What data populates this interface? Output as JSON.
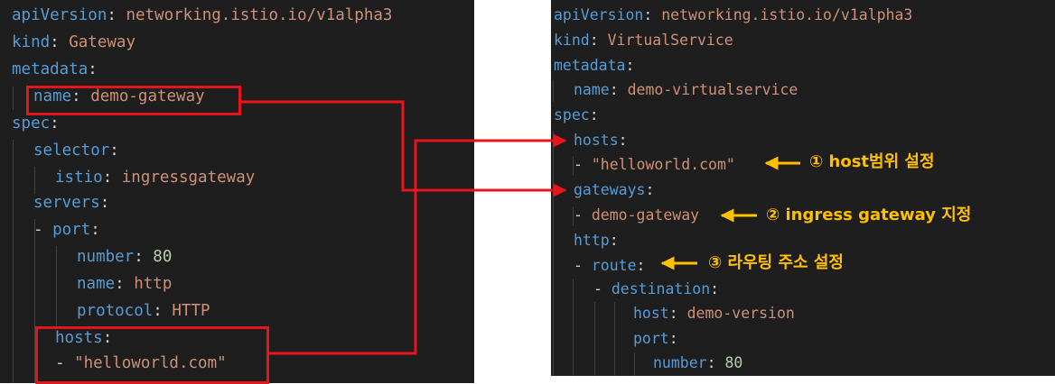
{
  "left": {
    "lines": [
      {
        "key": "apiVersion",
        "sep": ": ",
        "val": "networking.istio.io/v1alpha3"
      },
      {
        "key": "kind",
        "sep": ": ",
        "val": "Gateway"
      },
      {
        "key": "metadata",
        "sep": ":",
        "val": ""
      },
      {
        "key": "name",
        "sep": ": ",
        "val": "demo-gateway"
      },
      {
        "key": "spec",
        "sep": ":",
        "val": ""
      },
      {
        "key": "selector",
        "sep": ":",
        "val": ""
      },
      {
        "key": "istio",
        "sep": ": ",
        "val": "ingressgateway"
      },
      {
        "key": "servers",
        "sep": ":",
        "val": ""
      },
      {
        "dash": "- ",
        "key": "port",
        "sep": ":",
        "val": ""
      },
      {
        "key": "number",
        "sep": ": ",
        "val": "80"
      },
      {
        "key": "name",
        "sep": ": ",
        "val": "http"
      },
      {
        "key": "protocol",
        "sep": ": ",
        "val": "HTTP"
      },
      {
        "key": "hosts",
        "sep": ":",
        "val": ""
      },
      {
        "dash": "- ",
        "val": "\"helloworld.com\""
      }
    ]
  },
  "right": {
    "lines": [
      {
        "key": "apiVersion",
        "sep": ": ",
        "val": "networking.istio.io/v1alpha3"
      },
      {
        "key": "kind",
        "sep": ": ",
        "val": "VirtualService"
      },
      {
        "key": "metadata",
        "sep": ":",
        "val": ""
      },
      {
        "key": "name",
        "sep": ": ",
        "val": "demo-virtualservice"
      },
      {
        "key": "spec",
        "sep": ":",
        "val": ""
      },
      {
        "key": "hosts",
        "sep": ":",
        "val": ""
      },
      {
        "dash": "- ",
        "val": "\"helloworld.com\""
      },
      {
        "key": "gateways",
        "sep": ":",
        "val": ""
      },
      {
        "dash": "- ",
        "val": "demo-gateway"
      },
      {
        "key": "http",
        "sep": ":",
        "val": ""
      },
      {
        "dash": "- ",
        "key": "route",
        "sep": ":",
        "val": ""
      },
      {
        "dash": "- ",
        "key": "destination",
        "sep": ":",
        "val": ""
      },
      {
        "key": "host",
        "sep": ": ",
        "val": "demo-version"
      },
      {
        "key": "port",
        "sep": ":",
        "val": ""
      },
      {
        "key": "number",
        "sep": ": ",
        "val": "80"
      }
    ]
  },
  "annotations": [
    {
      "text": "① host범위 설정"
    },
    {
      "text": "② ingress gateway 지정"
    },
    {
      "text": "③ 라우팅 주소 설정"
    }
  ],
  "colors": {
    "key": "#569cd6",
    "string": "#ce9178",
    "number": "#b5cea8",
    "highlight": "#e8141b",
    "annotation": "#ffc000",
    "background": "#1e1e1e"
  }
}
